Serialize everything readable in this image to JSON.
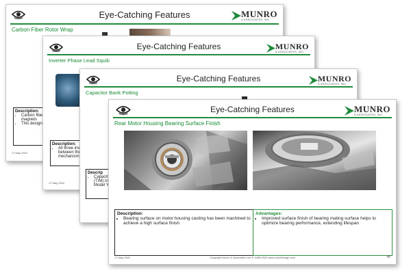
{
  "slides": [
    {
      "title": "Eye-Catching Features",
      "subtitle": "Carbon Fiber Rotor Wrap",
      "description_heading": "Description:",
      "description_bullets": [
        "Carbon fiber s",
        "magnets",
        "This design is"
      ],
      "date": "17 May 2022"
    },
    {
      "title": "Eye-Catching Features",
      "subtitle": "Inverter Phase Lead Squib",
      "description_heading": "Description:",
      "description_bullets": [
        "All three inver",
        "between the f",
        "mechanism in"
      ],
      "date": "17 May 2022"
    },
    {
      "title": "Eye-Catching Features",
      "subtitle": "Capacitor Bank Potting",
      "description_heading": "Descrip",
      "description_bullets": [
        "Capacit",
        "(TIM) in",
        "Model Y"
      ],
      "date": "17 May 2022"
    },
    {
      "title": "Eye-Catching Features",
      "subtitle": "Rear Motor Housing Bearing Surface Finish",
      "description_heading": "Description:",
      "description_bullets": [
        "Bearing surface on motor housing casting has been machined to achieve a high surface finish"
      ],
      "advantages_heading": "Advantages:",
      "advantages_bullets": [
        "Improved surface finish of bearing mating surface helps to optimize bearing performance, extending lifespan"
      ],
      "date": "17 May 2022",
      "copyright": "Copyright Munro & Associates Inc.® 1988-2022    www.LeanDesign.com",
      "page_number": "48"
    }
  ],
  "brand": {
    "name": "MUNRO",
    "tagline": "& ASSOCIATES, INC."
  },
  "icons": {
    "logo": "eye-icon",
    "brand_mark": "munro-chevron-icon"
  },
  "colors": {
    "accent_green": "#1f8a3a",
    "text": "#222222",
    "adv_border": "#2a8f3e"
  }
}
